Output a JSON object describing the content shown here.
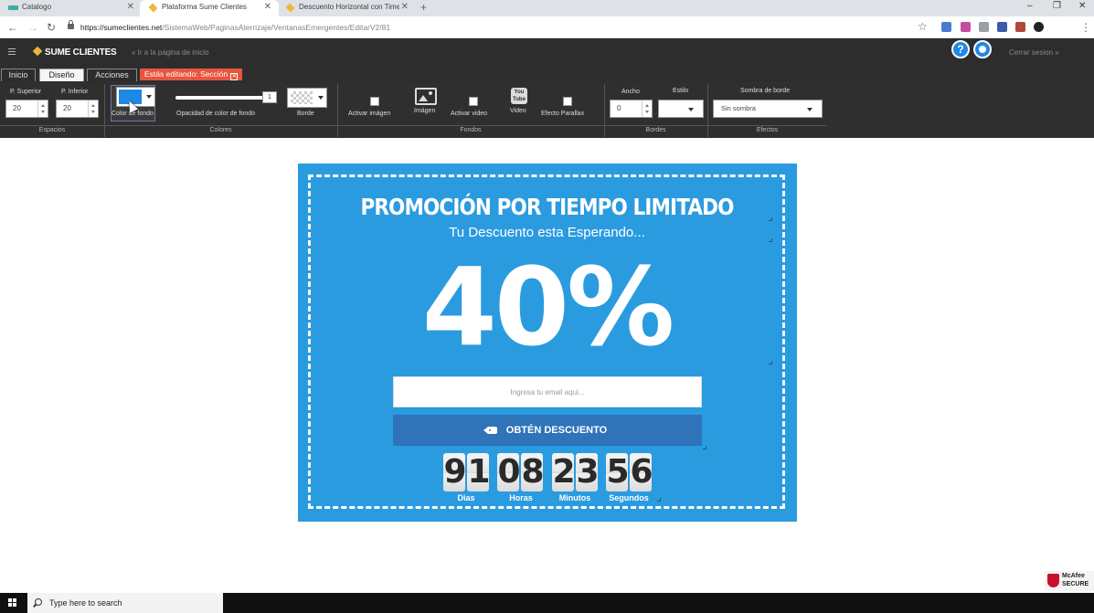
{
  "browser": {
    "tabs": [
      {
        "title": "Catalogo",
        "active": false
      },
      {
        "title": "Plataforma Sume Clientes",
        "active": true
      },
      {
        "title": "Descuento Horizontal con Timer",
        "active": false
      }
    ],
    "url_host": "https://sumeclientes.net",
    "url_path": "/SistemaWeb/PaginasAterrizaje/VentanasEmergentes/EditarV2/81"
  },
  "app": {
    "logo": "SUME CLIENTES",
    "back_link": "« Ir a la página de inicio",
    "help_icon": "?",
    "logout": "Cerrar sesion »"
  },
  "menu": {
    "tabs": [
      "Inicio",
      "Diseño",
      "Acciones"
    ],
    "editing_badge": "Estás editando: Sección"
  },
  "ribbon": {
    "spacing": {
      "top_label": "P. Superior",
      "top_value": "20",
      "bottom_label": "P. Inferior",
      "bottom_value": "20",
      "group": "Espacios"
    },
    "colors": {
      "bg_color_label": "Color de fondo",
      "bg_color": "#1e88e5",
      "opacity_label": "Opacidad de color de fondo",
      "opacity_value": "1",
      "border_label": "Borde",
      "group": "Colores"
    },
    "backgrounds": {
      "enable_image": "Activar imágen",
      "image": "Imágen",
      "enable_video": "Activar video",
      "video": "Video",
      "youtube_icon": "You Tube",
      "parallax": "Efecto Parallax",
      "group": "Fondos"
    },
    "borders": {
      "width_label": "Ancho",
      "width_value": "0",
      "style_label": "Estilo",
      "style_value": "",
      "group": "Bordes"
    },
    "effects": {
      "shadow_label": "Sombra de borde",
      "shadow_value": "Sin sombra",
      "group": "Efectos"
    }
  },
  "promo": {
    "title": "PROMOCIÓN POR TIEMPO LIMITADO",
    "subtitle": "Tu Descuento esta Esperando...",
    "discount": "40%",
    "email_placeholder": "Ingresa tu email aqui...",
    "cta": "OBTÉN DESCUENTO",
    "bg_color": "#2b9be0",
    "cta_color": "#2f73b8",
    "countdown": [
      {
        "digits": [
          "9",
          "1"
        ],
        "label": "Dias"
      },
      {
        "digits": [
          "0",
          "8"
        ],
        "label": "Horas"
      },
      {
        "digits": [
          "2",
          "3"
        ],
        "label": "Minutos"
      },
      {
        "digits": [
          "5",
          "6"
        ],
        "label": "Segundos"
      }
    ]
  },
  "taskbar": {
    "search_placeholder": "Type here to search"
  },
  "badge": {
    "line1": "McAfee",
    "line2": "SECURE"
  }
}
